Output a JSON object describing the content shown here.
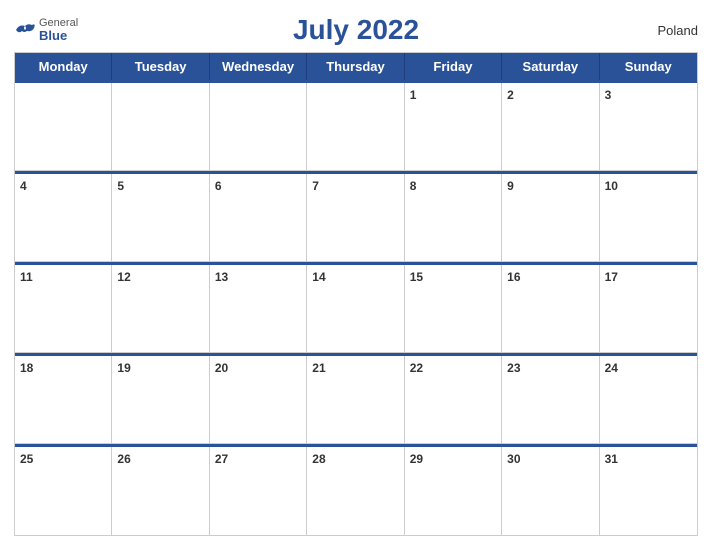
{
  "header": {
    "title": "July 2022",
    "country": "Poland",
    "logo": {
      "general": "General",
      "blue": "Blue"
    }
  },
  "days_of_week": [
    "Monday",
    "Tuesday",
    "Wednesday",
    "Thursday",
    "Friday",
    "Saturday",
    "Sunday"
  ],
  "weeks": [
    [
      {
        "day": "",
        "empty": true
      },
      {
        "day": "",
        "empty": true
      },
      {
        "day": "",
        "empty": true
      },
      {
        "day": "",
        "empty": true
      },
      {
        "day": "1"
      },
      {
        "day": "2"
      },
      {
        "day": "3"
      }
    ],
    [
      {
        "day": "4"
      },
      {
        "day": "5"
      },
      {
        "day": "6"
      },
      {
        "day": "7"
      },
      {
        "day": "8"
      },
      {
        "day": "9"
      },
      {
        "day": "10"
      }
    ],
    [
      {
        "day": "11"
      },
      {
        "day": "12"
      },
      {
        "day": "13"
      },
      {
        "day": "14"
      },
      {
        "day": "15"
      },
      {
        "day": "16"
      },
      {
        "day": "17"
      }
    ],
    [
      {
        "day": "18"
      },
      {
        "day": "19"
      },
      {
        "day": "20"
      },
      {
        "day": "21"
      },
      {
        "day": "22"
      },
      {
        "day": "23"
      },
      {
        "day": "24"
      }
    ],
    [
      {
        "day": "25"
      },
      {
        "day": "26"
      },
      {
        "day": "27"
      },
      {
        "day": "28"
      },
      {
        "day": "29"
      },
      {
        "day": "30"
      },
      {
        "day": "31"
      }
    ]
  ]
}
